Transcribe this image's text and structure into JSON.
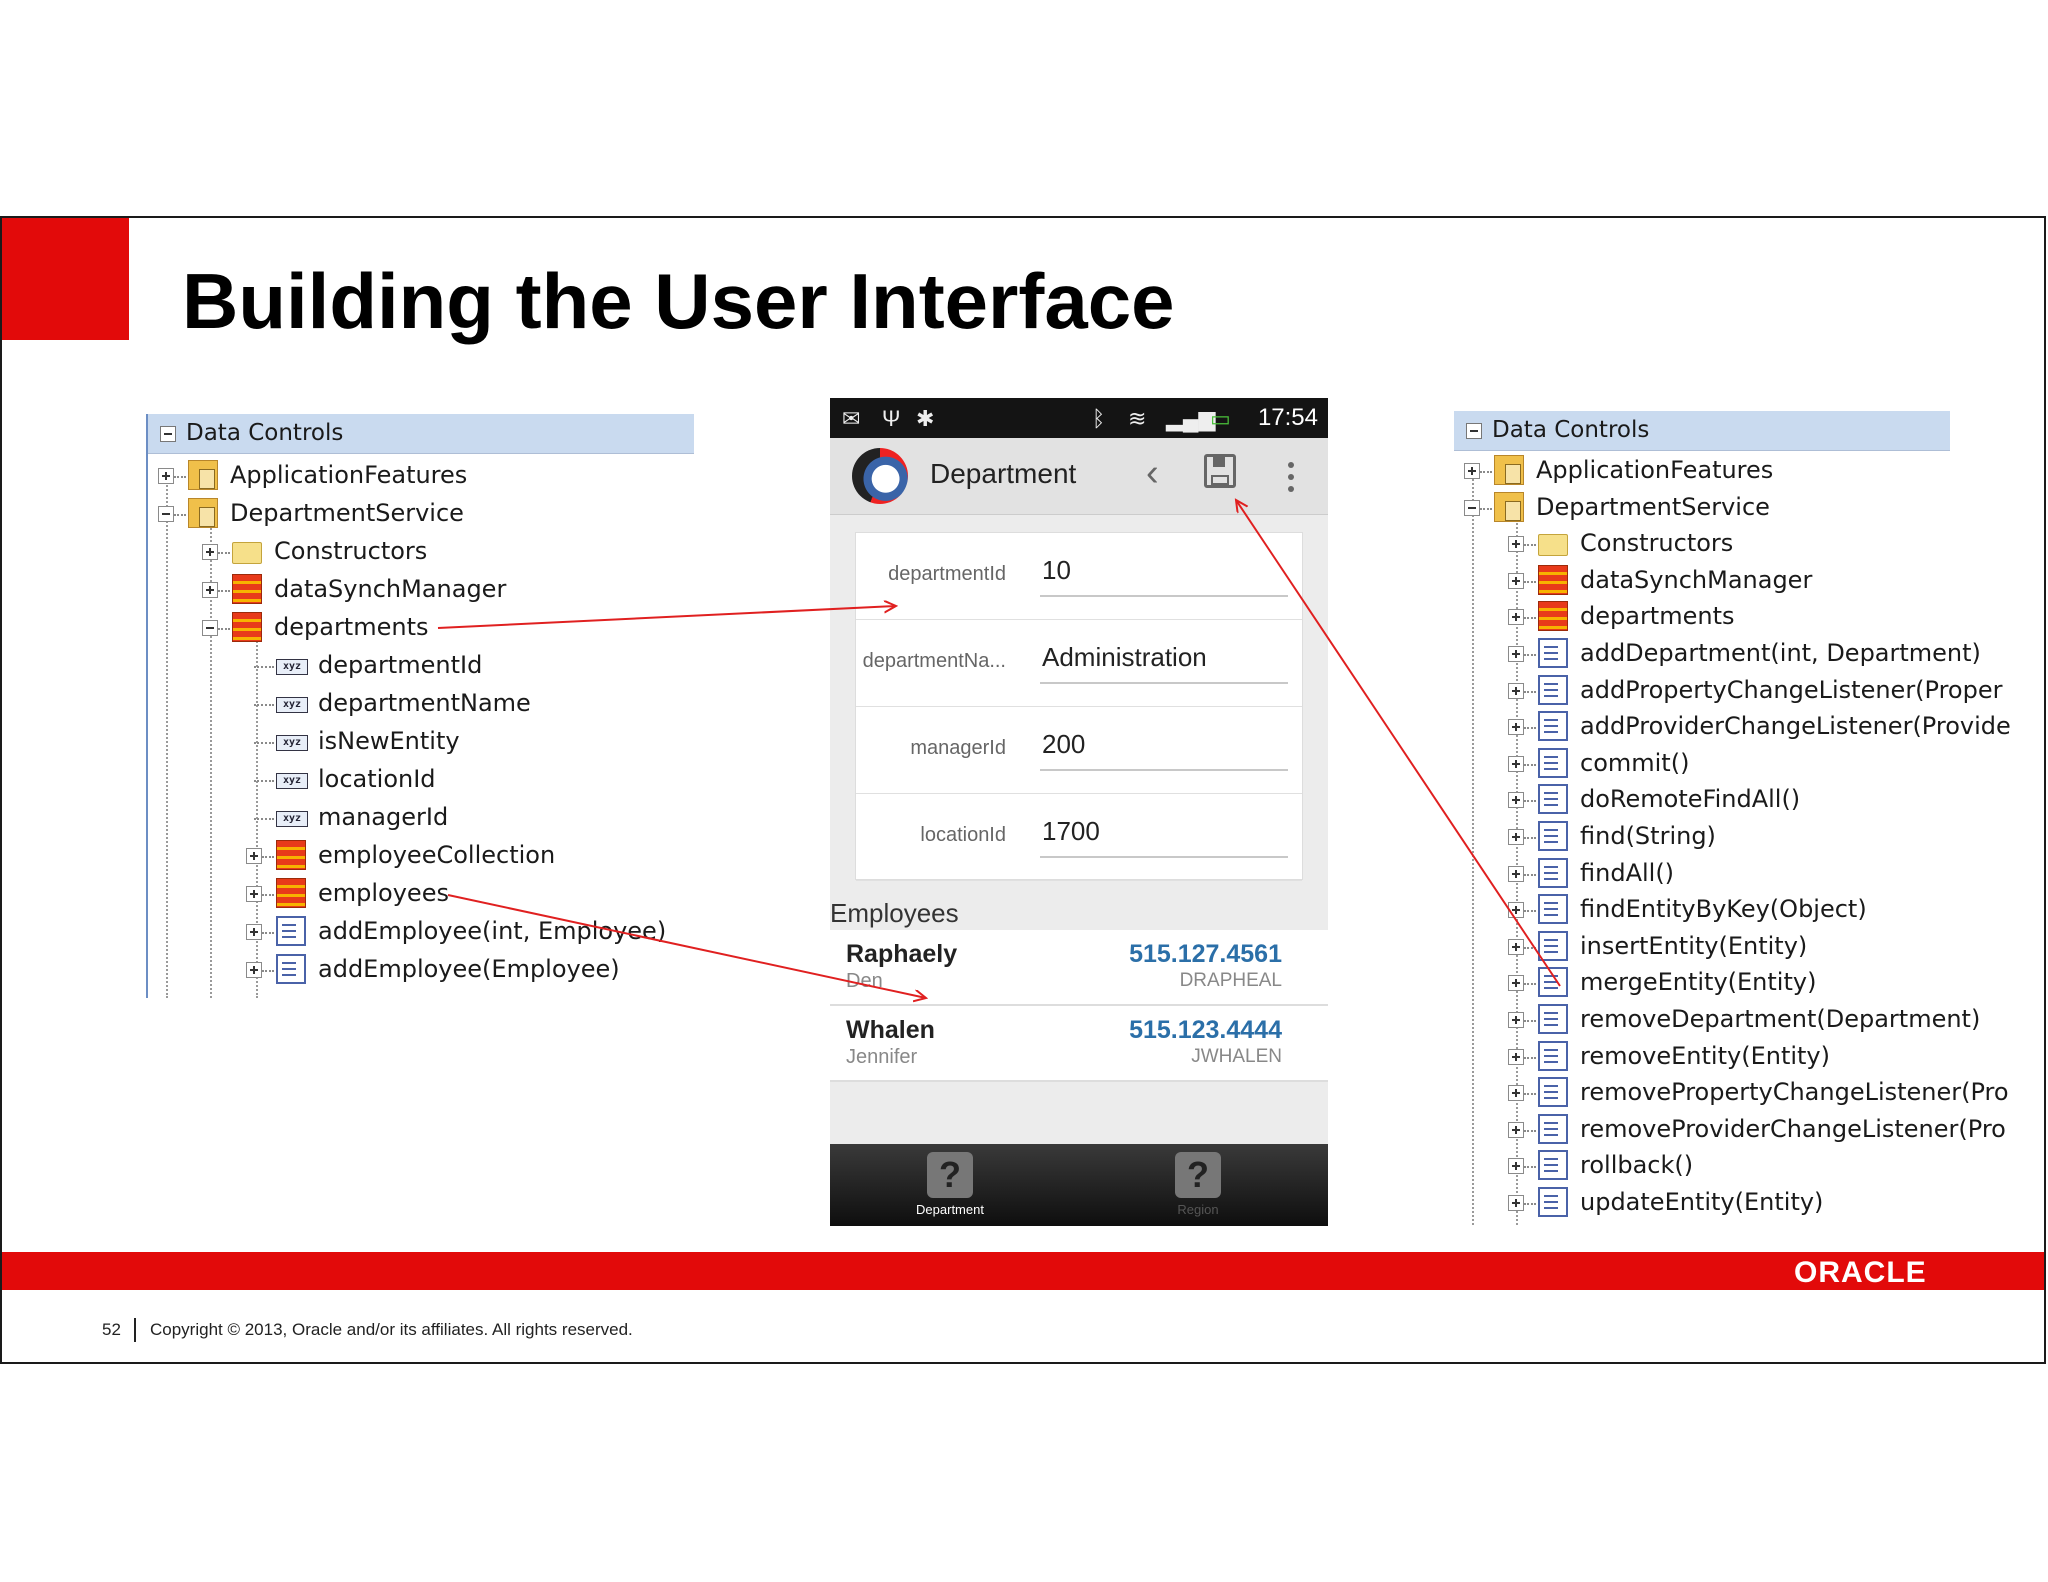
{
  "slide": {
    "title": "Building the User Interface",
    "footer": {
      "page_number": "52",
      "copyright": "Copyright © 2013, Oracle and/or its affiliates. All rights reserved.",
      "logo_text": "ORACLE"
    },
    "colors": {
      "accent_red": "#e20a0a",
      "link_blue": "#2b6fa8",
      "tree_header": "#c9daef"
    }
  },
  "left_tree": {
    "header": "Data Controls",
    "items": [
      {
        "label": "ApplicationFeatures",
        "icon": "app-module-icon"
      },
      {
        "label": "DepartmentService",
        "icon": "app-module-icon"
      },
      {
        "label": "Constructors",
        "icon": "folder-icon"
      },
      {
        "label": "dataSynchManager",
        "icon": "collection-icon"
      },
      {
        "label": "departments",
        "icon": "collection-icon"
      },
      {
        "label": "departmentId",
        "icon": "attribute-xyz-icon"
      },
      {
        "label": "departmentName",
        "icon": "attribute-xyz-icon"
      },
      {
        "label": "isNewEntity",
        "icon": "attribute-xyz-icon"
      },
      {
        "label": "locationId",
        "icon": "attribute-xyz-icon"
      },
      {
        "label": "managerId",
        "icon": "attribute-xyz-icon"
      },
      {
        "label": "employeeCollection",
        "icon": "collection-icon"
      },
      {
        "label": "employees",
        "icon": "collection-icon"
      },
      {
        "label": "addEmployee(int, Employee)",
        "icon": "method-icon"
      },
      {
        "label": "addEmployee(Employee)",
        "icon": "method-icon"
      }
    ]
  },
  "right_tree": {
    "header": "Data Controls",
    "items": [
      {
        "label": "ApplicationFeatures",
        "icon": "app-module-icon"
      },
      {
        "label": "DepartmentService",
        "icon": "app-module-icon"
      },
      {
        "label": "Constructors",
        "icon": "folder-icon"
      },
      {
        "label": "dataSynchManager",
        "icon": "collection-icon"
      },
      {
        "label": "departments",
        "icon": "collection-icon"
      },
      {
        "label": "addDepartment(int, Department)",
        "icon": "method-icon"
      },
      {
        "label": "addPropertyChangeListener(Proper",
        "icon": "method-icon"
      },
      {
        "label": "addProviderChangeListener(Provide",
        "icon": "method-icon"
      },
      {
        "label": "commit()",
        "icon": "method-icon"
      },
      {
        "label": "doRemoteFindAll()",
        "icon": "method-icon"
      },
      {
        "label": "find(String)",
        "icon": "method-icon"
      },
      {
        "label": "findAll()",
        "icon": "method-icon"
      },
      {
        "label": "findEntityByKey(Object)",
        "icon": "method-icon"
      },
      {
        "label": "insertEntity(Entity)",
        "icon": "method-icon"
      },
      {
        "label": "mergeEntity(Entity)",
        "icon": "method-icon"
      },
      {
        "label": "removeDepartment(Department)",
        "icon": "method-icon"
      },
      {
        "label": "removeEntity(Entity)",
        "icon": "method-icon"
      },
      {
        "label": "removePropertyChangeListener(Pro",
        "icon": "method-icon"
      },
      {
        "label": "removeProviderChangeListener(Pro",
        "icon": "method-icon"
      },
      {
        "label": "rollback()",
        "icon": "method-icon"
      },
      {
        "label": "updateEntity(Entity)",
        "icon": "method-icon"
      }
    ]
  },
  "phone": {
    "status_time": "17:54",
    "action_bar_title": "Department",
    "form": [
      {
        "label": "departmentId",
        "value": "10"
      },
      {
        "label": "departmentNa...",
        "value": "Administration"
      },
      {
        "label": "managerId",
        "value": "200"
      },
      {
        "label": "locationId",
        "value": "1700"
      }
    ],
    "employees_header": "Employees",
    "employees": [
      {
        "last": "Raphaely",
        "first": "Den",
        "phone": "515.127.4561",
        "user": "DRAPHEAL"
      },
      {
        "last": "Whalen",
        "first": "Jennifer",
        "phone": "515.123.4444",
        "user": "JWHALEN"
      }
    ],
    "tabs": [
      {
        "label": "Department",
        "icon": "question-icon"
      },
      {
        "label": "Region",
        "icon": "question-icon"
      }
    ]
  }
}
